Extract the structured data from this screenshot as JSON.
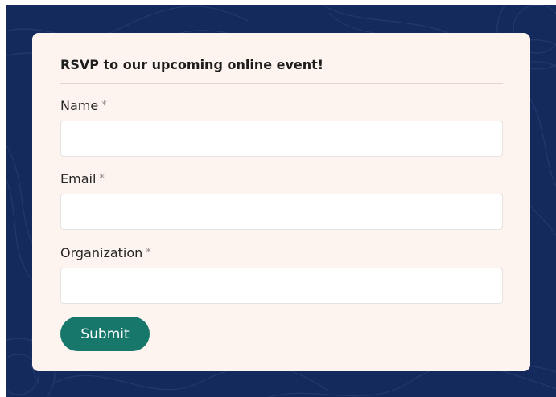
{
  "form": {
    "title": "RSVP to our upcoming online event!",
    "required_marker": "*",
    "fields": [
      {
        "label": "Name",
        "value": "",
        "placeholder": ""
      },
      {
        "label": "Email",
        "value": "",
        "placeholder": ""
      },
      {
        "label": "Organization",
        "value": "",
        "placeholder": ""
      }
    ],
    "submit_label": "Submit"
  },
  "colors": {
    "page_background": "#142a5c",
    "card_background": "#fdf3ef",
    "button": "#16776a",
    "button_text": "#ffffff"
  }
}
